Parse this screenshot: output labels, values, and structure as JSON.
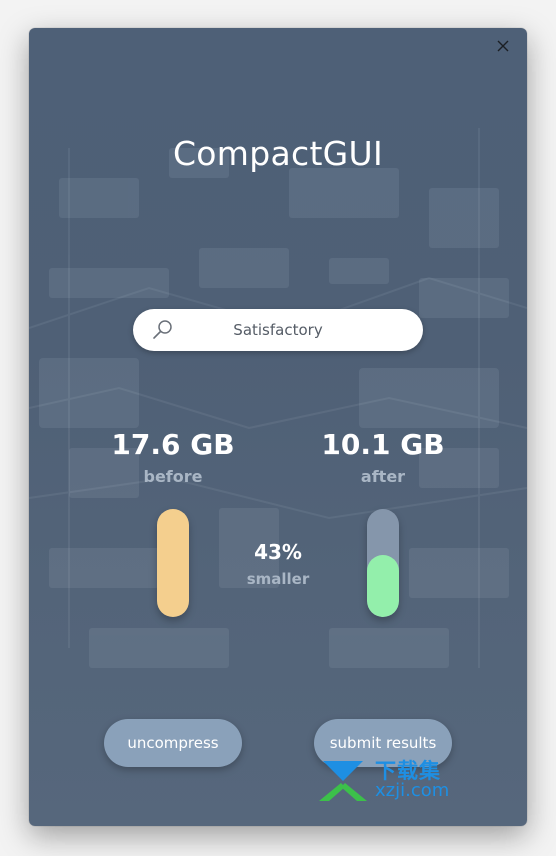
{
  "app": {
    "title": "CompactGUI"
  },
  "window_controls": {
    "close_icon": "close-icon"
  },
  "search": {
    "icon": "search-icon",
    "value": "Satisfactory"
  },
  "stats": {
    "before": {
      "value": "17.6 GB",
      "label": "before",
      "bar_color": "#f4cf8e",
      "fill_fraction": 1.0
    },
    "after": {
      "value": "10.1 GB",
      "label": "after",
      "bar_color": "#8596ab",
      "fill_color": "#93efab",
      "fill_fraction": 0.57
    },
    "reduction": {
      "value": "43%",
      "label": "smaller"
    }
  },
  "actions": {
    "uncompress_label": "uncompress",
    "submit_label": "submit results"
  },
  "watermark": {
    "cn_text": "下载集",
    "en_text": "xzji.com"
  },
  "colors": {
    "window_bg": "#4f6076",
    "button_bg": "#8aa1ba",
    "label_muted": "#a9b6c5"
  }
}
